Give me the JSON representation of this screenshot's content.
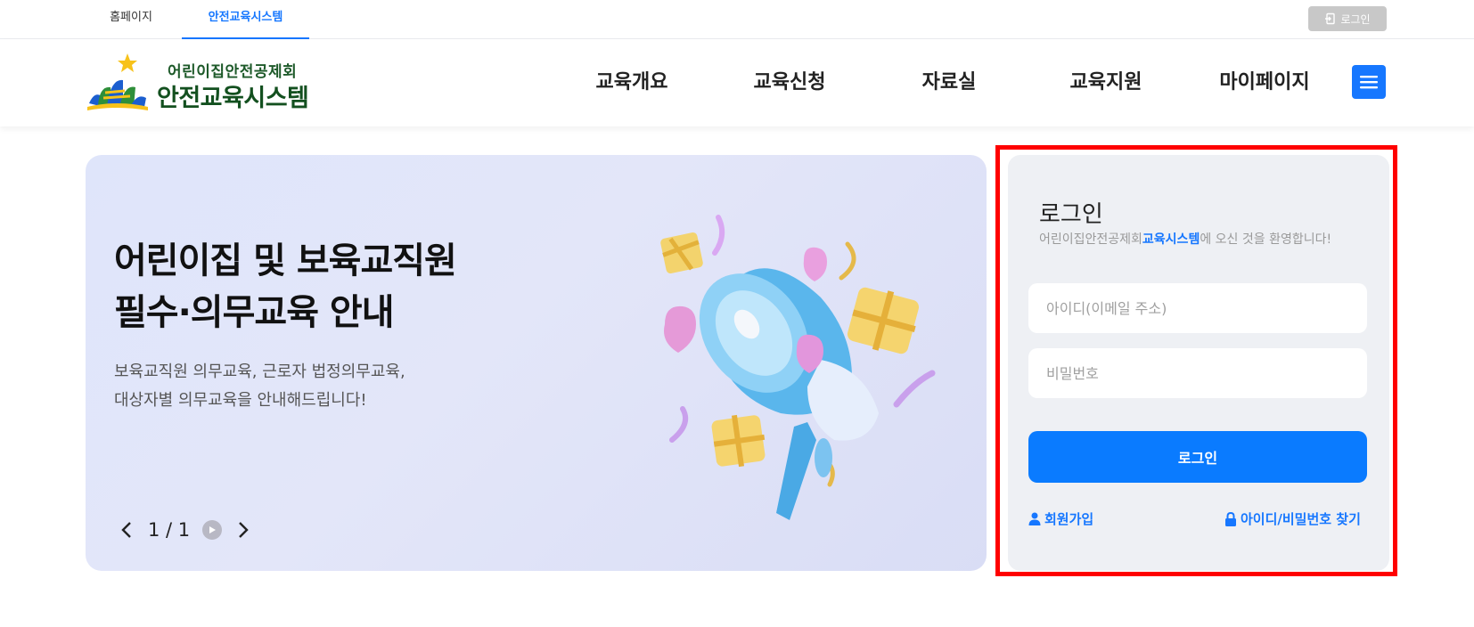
{
  "top_tabs": {
    "home": "홈페이지",
    "active": "안전교육시스템"
  },
  "top_login_label": "로그인",
  "logo": {
    "org": "어린이집안전공제회",
    "system": "안전교육시스템"
  },
  "nav": [
    "교육개요",
    "교육신청",
    "자료실",
    "교육지원",
    "마이페이지"
  ],
  "banner": {
    "title_line1": "어린이집 및 보육교직원",
    "title_line2": "필수·의무교육 안내",
    "desc_line1": "보육교직원 의무교육, 근로자 법정의무교육,",
    "desc_line2": "대상자별 의무교육을 안내해드립니다!",
    "pager": "1 / 1"
  },
  "login": {
    "title": "로그인",
    "sub_prefix": "어린이집안전공제회",
    "sub_highlight": "교육시스템",
    "sub_suffix": "에 오신 것을 환영합니다!",
    "id_placeholder": "아이디(이메일 주소)",
    "pw_placeholder": "비밀번호",
    "button": "로그인",
    "signup": "회원가입",
    "find": "아이디/비밀번호 찾기"
  },
  "colors": {
    "accent": "#1677ff",
    "highlight_border": "#ff0000"
  }
}
